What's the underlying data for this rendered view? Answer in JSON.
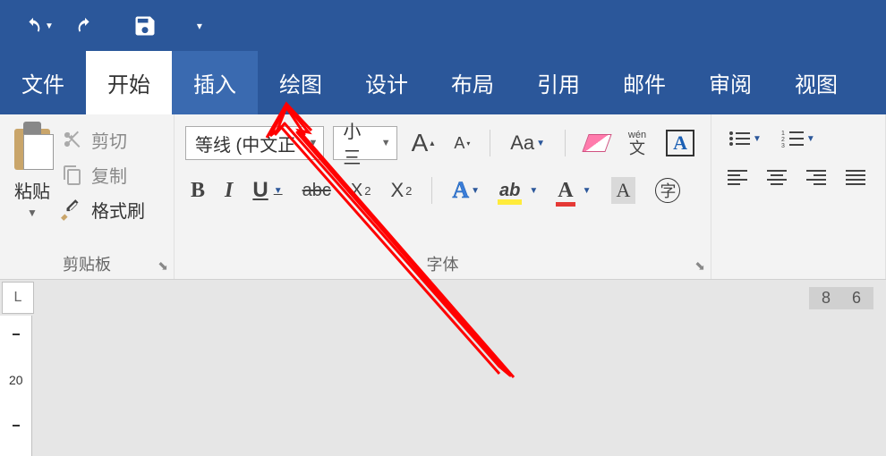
{
  "titlebar": {
    "undo_tip": "撤销",
    "redo_tip": "重做",
    "save_tip": "保存",
    "customize_tip": "自定义"
  },
  "tabs": {
    "file": "文件",
    "home": "开始",
    "insert": "插入",
    "draw": "绘图",
    "design": "设计",
    "layout": "布局",
    "references": "引用",
    "mailings": "邮件",
    "review": "审阅",
    "view": "视图"
  },
  "clipboard": {
    "paste": "粘贴",
    "cut": "剪切",
    "copy": "复制",
    "format_painter": "格式刷",
    "group_label": "剪贴板"
  },
  "font": {
    "font_name": "等线 (中文正",
    "font_size": "小三",
    "grow": "A",
    "shrink": "A",
    "change_case": "Aa",
    "phonetic_py": "wén",
    "phonetic_ch": "文",
    "char_border": "A",
    "bold": "B",
    "italic": "I",
    "underline": "U",
    "strike": "abc",
    "subscript": "X",
    "subscript_sub": "2",
    "superscript": "X",
    "superscript_sup": "2",
    "text_effects": "A",
    "highlight": "ab",
    "font_color": "A",
    "char_shading": "A",
    "enclosed": "字",
    "group_label": "字体"
  },
  "ruler": {
    "corner": "L",
    "num1": "8",
    "num2": "6",
    "vnum": "20"
  }
}
